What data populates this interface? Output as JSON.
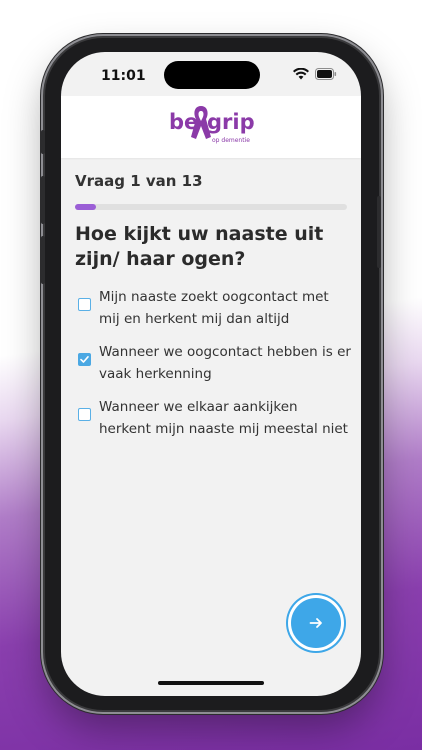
{
  "status_bar": {
    "time": "11:01"
  },
  "brand": {
    "name_part1": "be",
    "name_part2": "grip",
    "tagline": "op dementie",
    "color": "#8b3aa8"
  },
  "question": {
    "counter": "Vraag 1 van 13",
    "progress": 0.077,
    "title": "Hoe kijkt uw naaste uit zijn/ haar ogen?"
  },
  "options": [
    {
      "label": "Mijn naaste zoekt oogcontact met mij en herkent mij dan altijd",
      "checked": false
    },
    {
      "label": "Wanneer we oogcontact hebben is er vaak herkenning",
      "checked": true
    },
    {
      "label": "Wanneer we elkaar aankijken herkent mijn naaste mij meestal niet",
      "checked": false
    }
  ],
  "next_button": {
    "icon": "arrow-right-icon",
    "color": "#3ea7e8"
  },
  "accent": {
    "progress": "#9b5fd6",
    "checkbox": "#4ba8e3"
  }
}
